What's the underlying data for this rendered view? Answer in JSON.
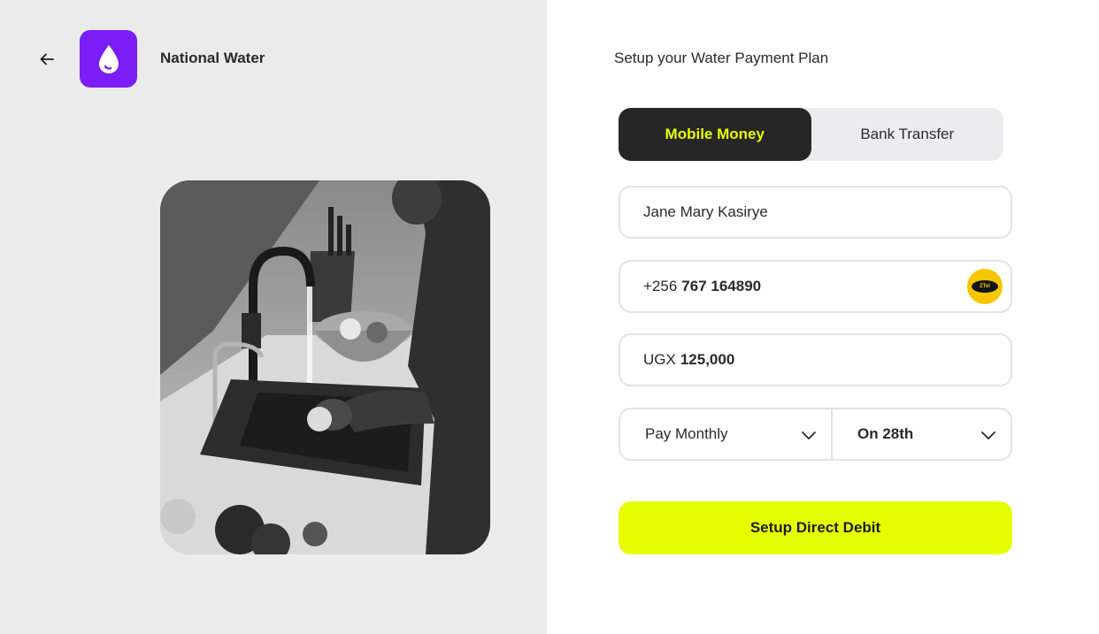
{
  "header": {
    "brand_name": "National Water",
    "back_icon": "arrow-left-icon",
    "logo_icon": "water-drop-icon",
    "logo_color": "#7a1df6"
  },
  "form": {
    "title": "Setup your Water Payment Plan",
    "payment_methods": [
      {
        "label": "Mobile Money",
        "active": true
      },
      {
        "label": "Bank Transfer",
        "active": false
      }
    ],
    "name_value": "Jane Mary Kasirye",
    "phone_prefix": "+256",
    "phone_number": "767 164890",
    "carrier_logo_text": "ZTel",
    "currency": "UGX",
    "amount": "125,000",
    "frequency": "Pay Monthly",
    "day": "On 28th",
    "submit_label": "Setup Direct Debit"
  },
  "colors": {
    "accent": "#e6ff00",
    "dark": "#262626",
    "panel_bg": "#ebebec",
    "carrier": "#f7c600"
  }
}
